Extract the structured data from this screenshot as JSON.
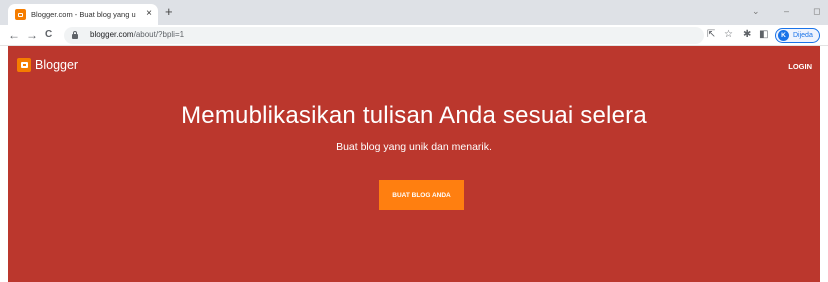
{
  "browser": {
    "tab": {
      "title": "Blogger.com - Buat blog yang u",
      "close": "×"
    },
    "new_tab": "+",
    "window_controls": {
      "dropdown": "⌄",
      "minimize": "–",
      "restore": "◻"
    },
    "nav": {
      "back": "←",
      "forward": "→",
      "reload": "C"
    },
    "address": {
      "domain": "blogger.com",
      "path": "/about/?bpli=1"
    },
    "toolbar_icons": {
      "share": "⇱",
      "bookmark": "☆",
      "extensions": "✱",
      "sidepanel": "◧"
    },
    "profile": {
      "initial": "K",
      "name": "Dijeda"
    }
  },
  "page": {
    "logo_text": "Blogger",
    "login": "LOGIN",
    "headline": "Memublikasikan tulisan Anda sesuai selera",
    "subline": "Buat blog yang unik dan menarik.",
    "cta": "BUAT BLOG ANDA"
  },
  "colors": {
    "hero_bg": "#bb372d",
    "cta_bg": "#ff7f10",
    "brand_orange": "#f57d00",
    "profile_blue": "#1a73e8"
  }
}
